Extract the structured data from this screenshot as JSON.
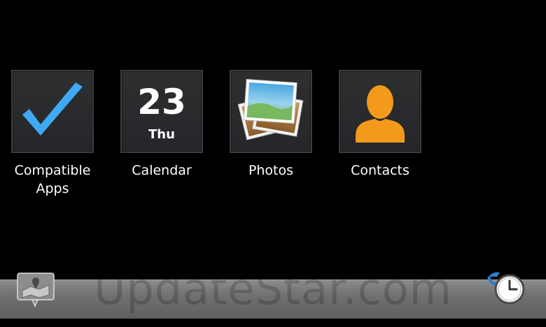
{
  "apps": [
    {
      "id": "compatible-apps",
      "label_line1": "Compatible",
      "label_line2": "Apps",
      "icon": "checkmark-icon"
    },
    {
      "id": "calendar",
      "label": "Calendar",
      "icon": "calendar-icon",
      "day": "23",
      "weekday": "Thu"
    },
    {
      "id": "photos",
      "label": "Photos",
      "icon": "photos-icon"
    },
    {
      "id": "contacts",
      "label": "Contacts",
      "icon": "contact-silhouette-icon"
    }
  ],
  "bottom_bar": {
    "watermark": "UpdateStar.com",
    "left_icon": "map-location-icon",
    "right_icon": "clock-icon"
  },
  "colors": {
    "check": "#3fa9f5",
    "contacts": "#f39a1c",
    "tile": "#2a2b2d"
  }
}
